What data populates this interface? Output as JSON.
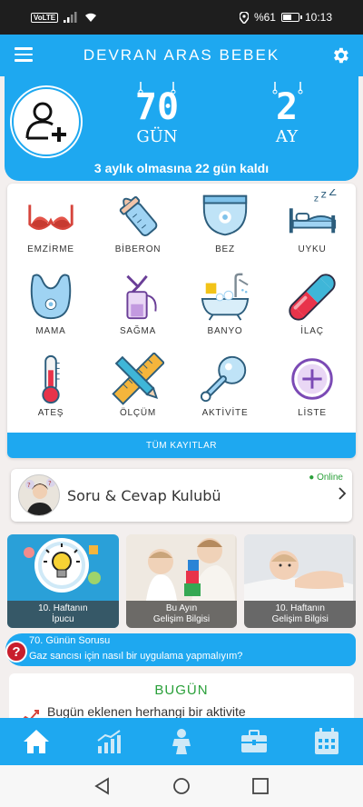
{
  "status": {
    "left_label": "VoLTE",
    "right_text": "%61",
    "time": "10:13",
    "battery_level": 0.61
  },
  "appbar": {
    "title": "DEVRAN ARAS BEBEK"
  },
  "hero": {
    "days": {
      "value": "70",
      "unit": "GÜN"
    },
    "months": {
      "value": "2",
      "unit": "AY"
    },
    "remaining": "3 aylık olmasına 22 gün kaldı"
  },
  "activities": [
    {
      "label": "EMZİRME",
      "icon": "bra-icon"
    },
    {
      "label": "BİBERON",
      "icon": "baby-bottle-icon"
    },
    {
      "label": "BEZ",
      "icon": "diaper-icon"
    },
    {
      "label": "UYKU",
      "icon": "bed-sleep-icon"
    },
    {
      "label": "MAMA",
      "icon": "bib-icon"
    },
    {
      "label": "SAĞMA",
      "icon": "breast-pump-icon"
    },
    {
      "label": "BANYO",
      "icon": "bathtub-icon"
    },
    {
      "label": "İLAÇ",
      "icon": "pill-icon"
    },
    {
      "label": "ATEŞ",
      "icon": "thermometer-icon"
    },
    {
      "label": "ÖLÇÜM",
      "icon": "ruler-pencil-icon"
    },
    {
      "label": "AKTİVİTE",
      "icon": "rattle-icon"
    },
    {
      "label": "LİSTE",
      "icon": "plus-circle-icon"
    }
  ],
  "all_records": "TÜM KAYITLAR",
  "qa": {
    "title": "Soru & Cevap Kulubü",
    "online": "● Online"
  },
  "thumbs": [
    {
      "line1": "10. Haftanın",
      "line2": "İpucu"
    },
    {
      "line1": "Bu Ayın",
      "line2": "Gelişim Bilgisi"
    },
    {
      "line1": "10. Haftanın",
      "line2": "Gelişim Bilgisi"
    }
  ],
  "question": {
    "title": "70. Günün Sorusu",
    "text": "Gaz sancısı için nasıl bir uygulama yapmalıyım?"
  },
  "today": {
    "heading": "BUGÜN",
    "message": "Bugün eklenen herhangi bir aktivite"
  },
  "colors": {
    "primary": "#1ea8f0",
    "online": "#2aa03a",
    "question_mark": "#c81e2c"
  },
  "bottom_nav": [
    "home-icon",
    "stats-icon",
    "baby-icon",
    "briefcase-icon",
    "calendar-icon"
  ]
}
